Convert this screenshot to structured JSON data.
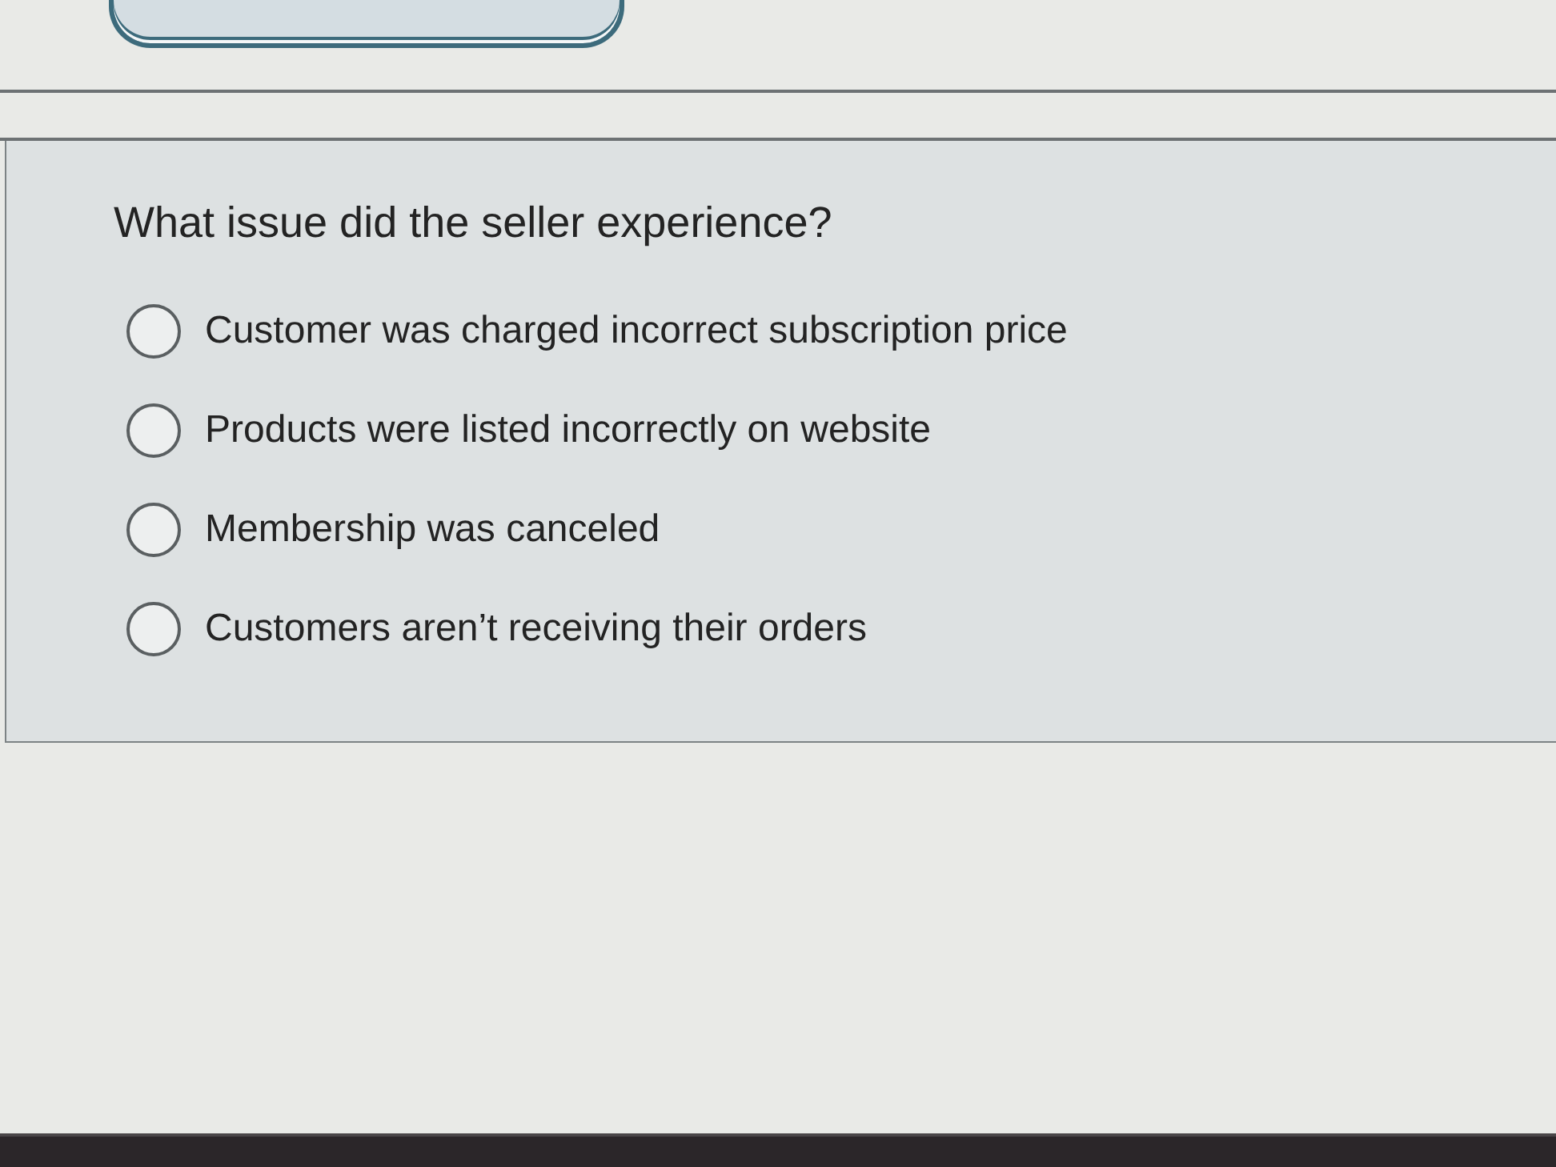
{
  "question": {
    "text": "What issue did the seller experience?"
  },
  "options": [
    {
      "label": "Customer was charged incorrect subscription price",
      "selected": false
    },
    {
      "label": "Products were listed incorrectly on website",
      "selected": false
    },
    {
      "label": "Membership was canceled",
      "selected": false
    },
    {
      "label": "Customers aren’t receiving their orders",
      "selected": false
    }
  ]
}
